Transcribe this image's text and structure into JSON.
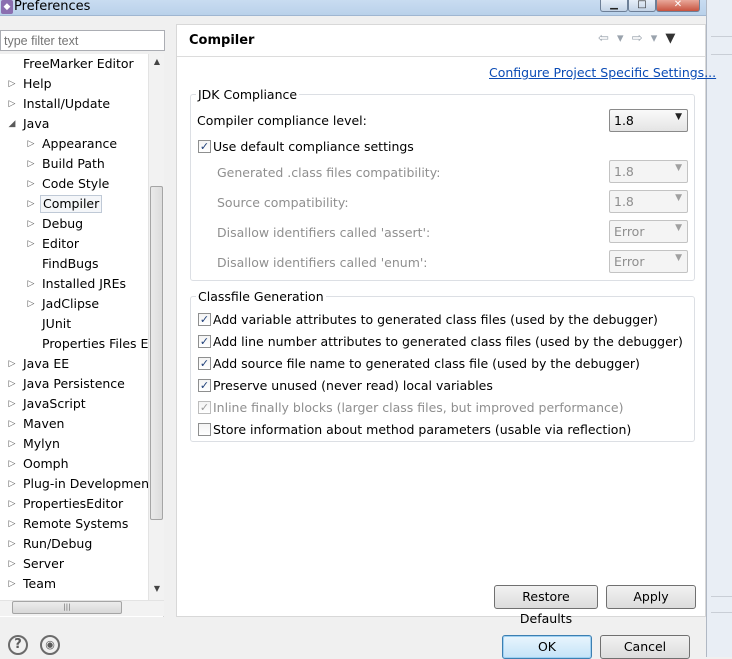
{
  "window": {
    "title": "Preferences",
    "minimize_glyph": "▁",
    "maximize_glyph": "□",
    "close_glyph": "✕",
    "icon_glyph": "◆"
  },
  "filter": {
    "placeholder": "type filter text"
  },
  "tree": {
    "items": [
      {
        "label": "FreeMarker Editor",
        "level": 0,
        "expander": ""
      },
      {
        "label": "Help",
        "level": 0,
        "expander": "▷"
      },
      {
        "label": "Install/Update",
        "level": 0,
        "expander": "▷"
      },
      {
        "label": "Java",
        "level": 0,
        "expander": "◢"
      },
      {
        "label": "Appearance",
        "level": 1,
        "expander": "▷"
      },
      {
        "label": "Build Path",
        "level": 1,
        "expander": "▷"
      },
      {
        "label": "Code Style",
        "level": 1,
        "expander": "▷"
      },
      {
        "label": "Compiler",
        "level": 1,
        "expander": "▷",
        "selected": true
      },
      {
        "label": "Debug",
        "level": 1,
        "expander": "▷"
      },
      {
        "label": "Editor",
        "level": 1,
        "expander": "▷"
      },
      {
        "label": "FindBugs",
        "level": 1,
        "expander": ""
      },
      {
        "label": "Installed JREs",
        "level": 1,
        "expander": "▷"
      },
      {
        "label": "JadClipse",
        "level": 1,
        "expander": "▷"
      },
      {
        "label": "JUnit",
        "level": 1,
        "expander": ""
      },
      {
        "label": "Properties Files Ed",
        "level": 1,
        "expander": ""
      },
      {
        "label": "Java EE",
        "level": 0,
        "expander": "▷"
      },
      {
        "label": "Java Persistence",
        "level": 0,
        "expander": "▷"
      },
      {
        "label": "JavaScript",
        "level": 0,
        "expander": "▷"
      },
      {
        "label": "Maven",
        "level": 0,
        "expander": "▷"
      },
      {
        "label": "Mylyn",
        "level": 0,
        "expander": "▷"
      },
      {
        "label": "Oomph",
        "level": 0,
        "expander": "▷"
      },
      {
        "label": "Plug-in Development",
        "level": 0,
        "expander": "▷"
      },
      {
        "label": "PropertiesEditor",
        "level": 0,
        "expander": "▷"
      },
      {
        "label": "Remote Systems",
        "level": 0,
        "expander": "▷"
      },
      {
        "label": "Run/Debug",
        "level": 0,
        "expander": "▷"
      },
      {
        "label": "Server",
        "level": 0,
        "expander": "▷"
      },
      {
        "label": "Team",
        "level": 0,
        "expander": "▷"
      }
    ],
    "scroll_up": "▲",
    "scroll_down": "▼",
    "hscroll_grip": "|||"
  },
  "page": {
    "title": "Compiler",
    "nav_back": "⇦ ▾",
    "nav_forward": "⇨ ▾",
    "menu": "▼",
    "config_link": "Configure Project Specific Settings..."
  },
  "jdk": {
    "legend": "JDK Compliance",
    "compliance_label": "Compiler compliance level:",
    "compliance_value": "1.8",
    "use_default_label": "Use default compliance settings",
    "use_default_checked": "✓",
    "rows": [
      {
        "label": "Generated .class files compatibility:",
        "value": "1.8"
      },
      {
        "label": "Source compatibility:",
        "value": "1.8"
      },
      {
        "label": "Disallow identifiers called 'assert':",
        "value": "Error"
      },
      {
        "label": "Disallow identifiers called 'enum':",
        "value": "Error"
      }
    ],
    "combo_arrow": "▼"
  },
  "classfile": {
    "legend": "Classfile Generation",
    "options": [
      {
        "label": "Add variable attributes to generated class files (used by the debugger)",
        "check": "✓"
      },
      {
        "label": "Add line number attributes to generated class files (used by the debugger)",
        "check": "✓"
      },
      {
        "label": "Add source file name to generated class file (used by the debugger)",
        "check": "✓"
      },
      {
        "label": "Preserve unused (never read) local variables",
        "check": "✓"
      },
      {
        "label": "Inline finally blocks (larger class files, but improved performance)",
        "check": "✓"
      },
      {
        "label": "Store information about method parameters (usable via reflection)",
        "check": ""
      }
    ]
  },
  "buttons": {
    "restore": "Restore Defaults",
    "apply": "Apply",
    "ok": "OK",
    "cancel": "Cancel",
    "help_glyph": "?",
    "import_glyph": "◉"
  }
}
